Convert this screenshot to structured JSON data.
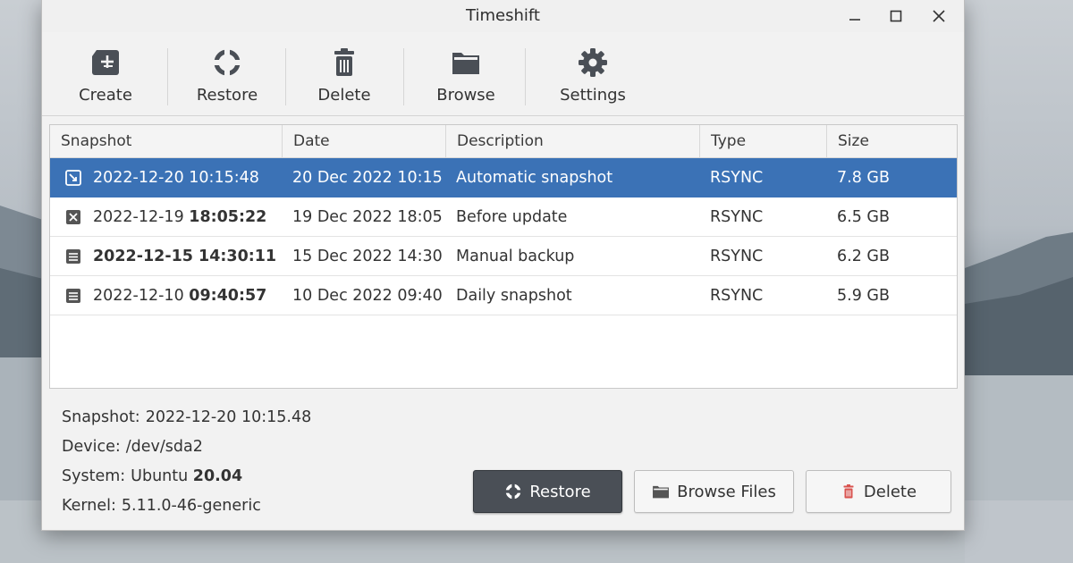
{
  "window": {
    "title": "Timeshift"
  },
  "toolbar": {
    "create": {
      "label": "Create",
      "icon": "create-snapshot-icon"
    },
    "restore": {
      "label": "Restore",
      "icon": "restore-icon"
    },
    "delete": {
      "label": "Delete",
      "icon": "trash-icon"
    },
    "browse": {
      "label": "Browse",
      "icon": "folder-icon"
    },
    "settings": {
      "label": "Settings",
      "icon": "gear-icon"
    }
  },
  "table": {
    "columns": [
      "Snapshot",
      "Date",
      "Description",
      "Type",
      "Size"
    ],
    "rows": [
      {
        "snapshot_date": "2022-12-20",
        "snapshot_time": "10:15:48",
        "date": "20 Dec 2022 10:15",
        "description": "Automatic snapshot",
        "type": "RSYNC",
        "size": "7.8 GB",
        "selected": true
      },
      {
        "snapshot_date": "2022-12-19",
        "snapshot_time": "18:05:22",
        "date": "19 Dec 2022 18:05",
        "description": "Before update",
        "type": "RSYNC",
        "size": "6.5 GB",
        "selected": false
      },
      {
        "snapshot_date": "2022-12-15",
        "snapshot_time": "14:30:11",
        "date": "15 Dec 2022 14:30",
        "description": "Manual backup",
        "type": "RSYNC",
        "size": "6.2 GB",
        "selected": false
      },
      {
        "snapshot_date": "2022-12-10",
        "snapshot_time": "09:40:57",
        "date": "10 Dec 2022 09:40",
        "description": "Daily snapshot",
        "type": "RSYNC",
        "size": "5.9 GB",
        "selected": false
      }
    ]
  },
  "details": {
    "snapshot_label": "Snapshot:",
    "snapshot_value": "2022-12-20 10:15.48",
    "device_label": "Device:",
    "device_value": "/dev/sda2",
    "system_label": "System:",
    "system_name": "Ubuntu",
    "system_version": "20.04",
    "kernel_label": "Kernel:",
    "kernel_value": "5.11.0-46-generic"
  },
  "actions": {
    "restore_label": "Restore",
    "browse_label": "Browse Files",
    "delete_label": "Delete"
  },
  "colors": {
    "selection": "#3b72b6",
    "primary_button": "#4a4f56",
    "delete_icon": "#d9534f"
  }
}
